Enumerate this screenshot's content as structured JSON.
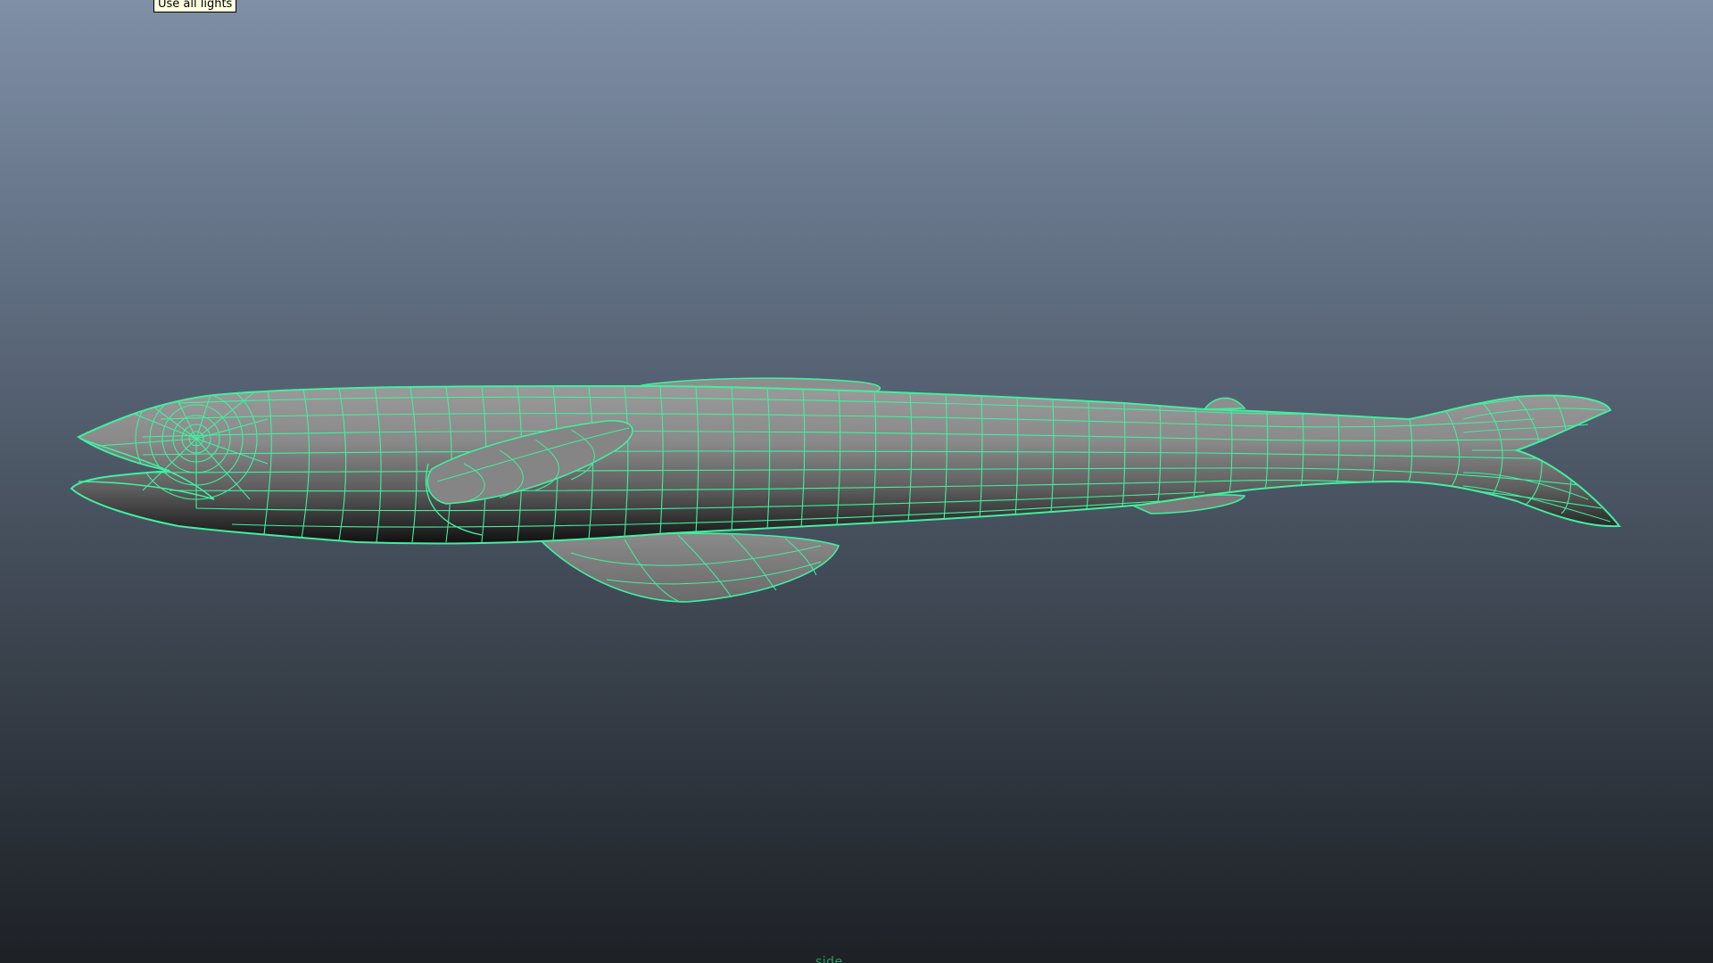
{
  "viewport": {
    "tooltip_text": "Use all lights",
    "camera_name": "side",
    "wireframe_color": "#40f0a0",
    "shading_color": "#888888",
    "background_top": "#7f8fa6",
    "background_bottom": "#1d2126"
  },
  "model": {
    "icon": "fish-mesh-icon"
  }
}
